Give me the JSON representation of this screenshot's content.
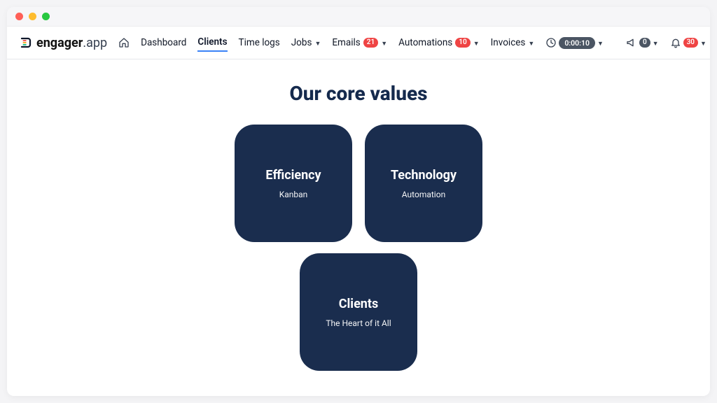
{
  "brand": {
    "bold": "engager",
    "thin": ".app"
  },
  "nav": {
    "dashboard": "Dashboard",
    "clients": "Clients",
    "timelogs": "Time logs",
    "jobs": "Jobs",
    "emails": "Emails",
    "emails_badge": "21",
    "automations": "Automations",
    "automations_badge": "10",
    "invoices": "Invoices",
    "timer": "0:00:10",
    "announce_badge": "0",
    "bell_badge": "30"
  },
  "page": {
    "headline": "Our core values",
    "cards": {
      "efficiency": {
        "title": "Efficiency",
        "sub": "Kanban"
      },
      "technology": {
        "title": "Technology",
        "sub": "Automation"
      },
      "clients": {
        "title": "Clients",
        "sub": "The Heart of it All"
      }
    }
  }
}
